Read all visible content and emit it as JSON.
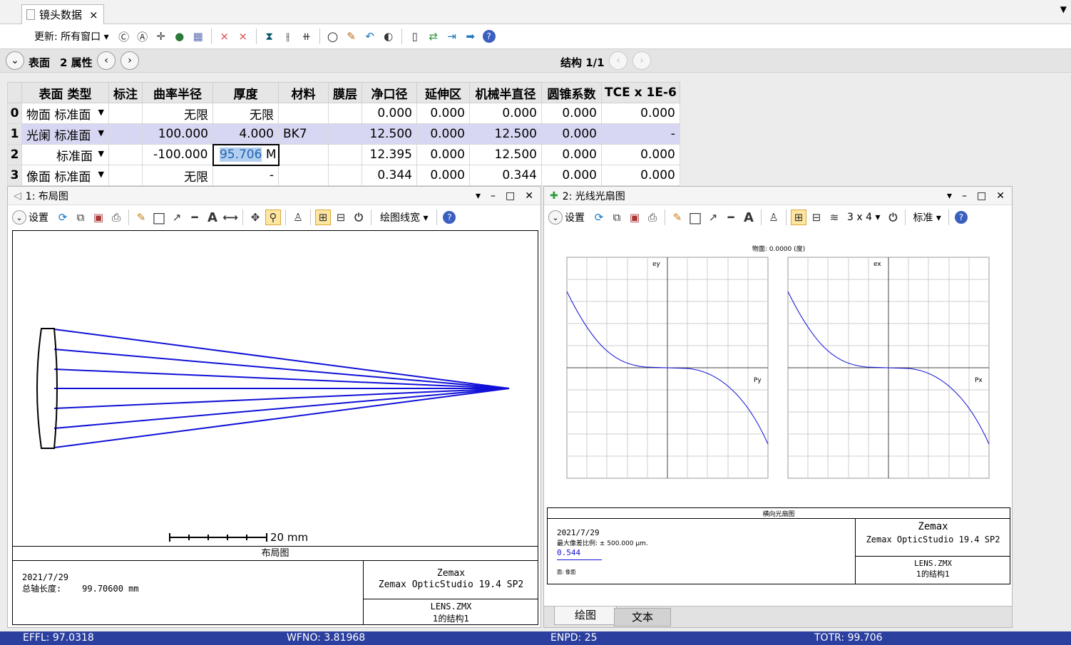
{
  "tab": {
    "title": "镜头数据",
    "close": "×"
  },
  "toolbar": {
    "update_label": "更新: 所有窗口"
  },
  "nav": {
    "surface_label": "表面",
    "props_label": "2 属性",
    "config_label": "结构 1/1"
  },
  "table": {
    "headers": [
      "表面 类型",
      "标注",
      "曲率半径",
      "厚度",
      "材料",
      "膜层",
      "净口径",
      "延伸区",
      "机械半直径",
      "圆锥系数",
      "TCE x 1E-6"
    ],
    "rows": [
      {
        "num": "0",
        "name": "物面",
        "type": "标准面",
        "comment": "",
        "radius": "无限",
        "thickness": "无限",
        "tflag": "",
        "material": "",
        "coating": "",
        "clear": "0.000",
        "chip": "0.000",
        "mech": "0.000",
        "conic": "0.000",
        "tce": "0.000"
      },
      {
        "num": "1",
        "name": "光阑",
        "type": "标准面",
        "comment": "",
        "radius": "100.000",
        "thickness": "4.000",
        "tflag": "",
        "material": "BK7",
        "coating": "",
        "clear": "12.500",
        "chip": "0.000",
        "mech": "12.500",
        "conic": "0.000",
        "tce": "-"
      },
      {
        "num": "2",
        "name": "",
        "type": "标准面",
        "comment": "",
        "radius": "-100.000",
        "thickness": "95.706",
        "tflag": "M",
        "material": "",
        "coating": "",
        "clear": "12.395",
        "chip": "0.000",
        "mech": "12.500",
        "conic": "0.000",
        "tce": "0.000"
      },
      {
        "num": "3",
        "name": "像面",
        "type": "标准面",
        "comment": "",
        "radius": "无限",
        "thickness": "-",
        "tflag": "",
        "material": "",
        "coating": "",
        "clear": "0.344",
        "chip": "0.000",
        "mech": "0.344",
        "conic": "0.000",
        "tce": "0.000"
      }
    ]
  },
  "layout": {
    "title": "1: 布局图",
    "settings": "设置",
    "linewidth": "绘图线宽",
    "scale_label": "20 mm",
    "plot_title": "布局图",
    "date": "2021/7/29",
    "axial_label": "总轴长度:",
    "axial_value": "99.70600 mm",
    "company": "Zemax",
    "product": "Zemax OpticStudio 19.4 SP2",
    "file": "LENS.ZMX",
    "config": "1的结构1"
  },
  "fan": {
    "title": "2: 光线光扇图",
    "settings": "设置",
    "grid_label": "3 x 4",
    "standard_label": "标准",
    "field_label": "物面: 0.0000 (度)",
    "ey_label": "ey",
    "ex_label": "ex",
    "py_label": "Py",
    "px_label": "Px",
    "plot_title": "横向光扇图",
    "date": "2021/7/29",
    "max_scale": "最大像差比例: ± 500.000 µm.",
    "wavelength": "0.544",
    "surface_label": "面: 像面",
    "company": "Zemax",
    "product": "Zemax OpticStudio 19.4 SP2",
    "file": "LENS.ZMX",
    "config": "1的结构1",
    "tab_graph": "绘图",
    "tab_text": "文本"
  },
  "status": {
    "effl": "EFFL: 97.0318",
    "wfno": "WFNO: 3.81968",
    "enpd": "ENPD: 25",
    "totr": "TOTR: 99.706"
  },
  "colors": {
    "ray": "#1010d8",
    "status_bar": "#2b3f9e",
    "selected_row": "#d7d7f3"
  },
  "icons": {
    "refresh": "refresh-icon",
    "help": "help-icon",
    "zoom": "magnifier-icon",
    "close": "close-icon"
  }
}
